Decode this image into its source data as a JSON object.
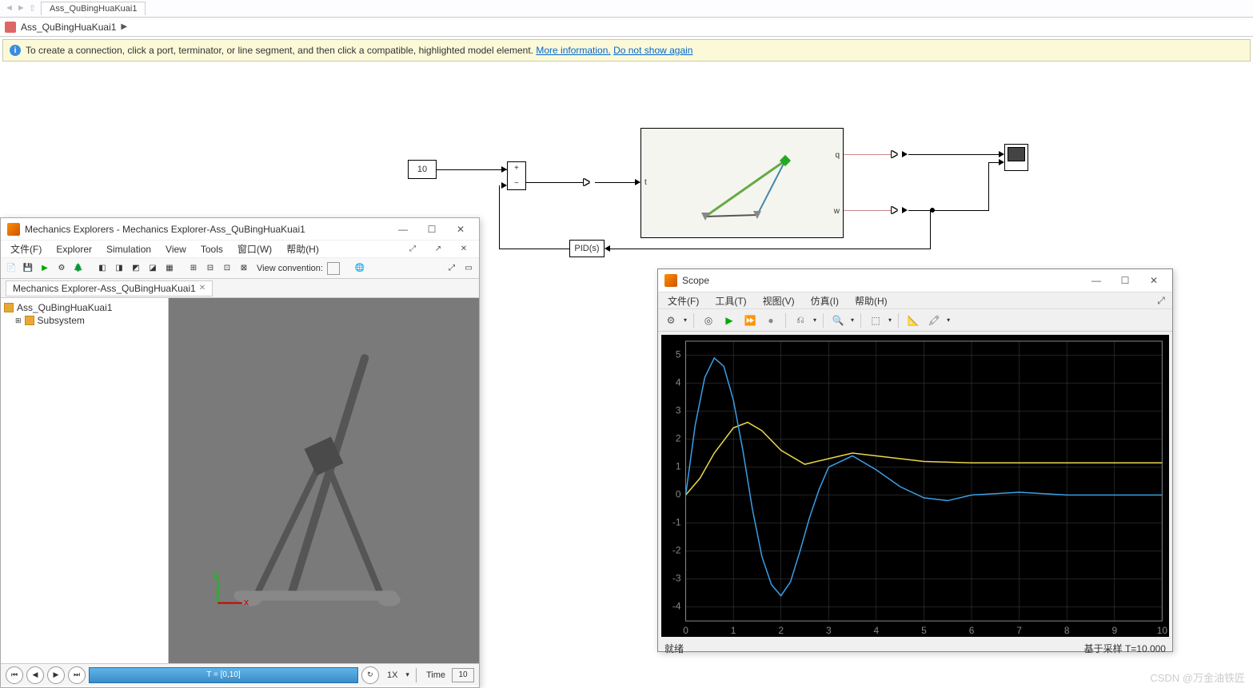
{
  "tab": {
    "name": "Ass_QuBingHuaKuai1"
  },
  "breadcrumb": {
    "root": "Ass_QuBingHuaKuai1"
  },
  "info": {
    "text": "To create a connection, click a port, terminator, or line segment, and then click a compatible, highlighted model element.",
    "more": "More information.",
    "dismiss": "Do not show again"
  },
  "blocks": {
    "constant": "10",
    "pid": "PID(s)",
    "subsys_ports": {
      "t": "t",
      "q": "q",
      "w": "w"
    },
    "sum": {
      "plus": "+",
      "minus": "−"
    }
  },
  "mechanics_explorer": {
    "title": "Mechanics Explorers - Mechanics Explorer-Ass_QuBingHuaKuai1",
    "menu": [
      "文件(F)",
      "Explorer",
      "Simulation",
      "View",
      "Tools",
      "窗口(W)",
      "帮助(H)"
    ],
    "view_convention": "View convention:",
    "tab": "Mechanics Explorer-Ass_QuBingHuaKuai1",
    "tree": {
      "root": "Ass_QuBingHuaKuai1",
      "child": "Subsystem"
    },
    "playback": {
      "slider": "T = [0,10]",
      "speed": "1X",
      "time_label": "Time",
      "time_value": "10"
    }
  },
  "scope": {
    "title": "Scope",
    "menu": [
      "文件(F)",
      "工具(T)",
      "视图(V)",
      "仿真(I)",
      "帮助(H)"
    ],
    "status_left": "就绪",
    "status_right": "基于采样    T=10.000"
  },
  "watermark": "CSDN @万金油铁匠",
  "chart_data": {
    "type": "line",
    "title": "",
    "xlabel": "",
    "ylabel": "",
    "xlim": [
      0,
      10
    ],
    "ylim": [
      -4.5,
      5.5
    ],
    "x_ticks": [
      0,
      1,
      2,
      3,
      4,
      5,
      6,
      7,
      8,
      9,
      10
    ],
    "y_ticks": [
      -4,
      -3,
      -2,
      -1,
      0,
      1,
      2,
      3,
      4,
      5
    ],
    "series": [
      {
        "name": "q",
        "color": "#e8d84a",
        "x": [
          0,
          0.3,
          0.6,
          1.0,
          1.3,
          1.6,
          2.0,
          2.5,
          3.0,
          3.5,
          4.0,
          5.0,
          6.0,
          7.0,
          8.0,
          9.0,
          10.0
        ],
        "y": [
          0,
          0.6,
          1.5,
          2.4,
          2.6,
          2.3,
          1.6,
          1.1,
          1.3,
          1.5,
          1.4,
          1.2,
          1.15,
          1.15,
          1.15,
          1.15,
          1.15
        ]
      },
      {
        "name": "w",
        "color": "#3aa0e8",
        "x": [
          0,
          0.2,
          0.4,
          0.6,
          0.8,
          1.0,
          1.2,
          1.4,
          1.6,
          1.8,
          2.0,
          2.2,
          2.4,
          2.6,
          2.8,
          3.0,
          3.5,
          4.0,
          4.5,
          5.0,
          5.5,
          6.0,
          7.0,
          8.0,
          9.0,
          10.0
        ],
        "y": [
          0,
          2.5,
          4.2,
          4.9,
          4.6,
          3.4,
          1.6,
          -0.5,
          -2.2,
          -3.2,
          -3.6,
          -3.1,
          -2.0,
          -0.8,
          0.2,
          1.0,
          1.4,
          0.9,
          0.3,
          -0.1,
          -0.2,
          0.0,
          0.1,
          0.0,
          0.0,
          0.0
        ]
      }
    ]
  }
}
